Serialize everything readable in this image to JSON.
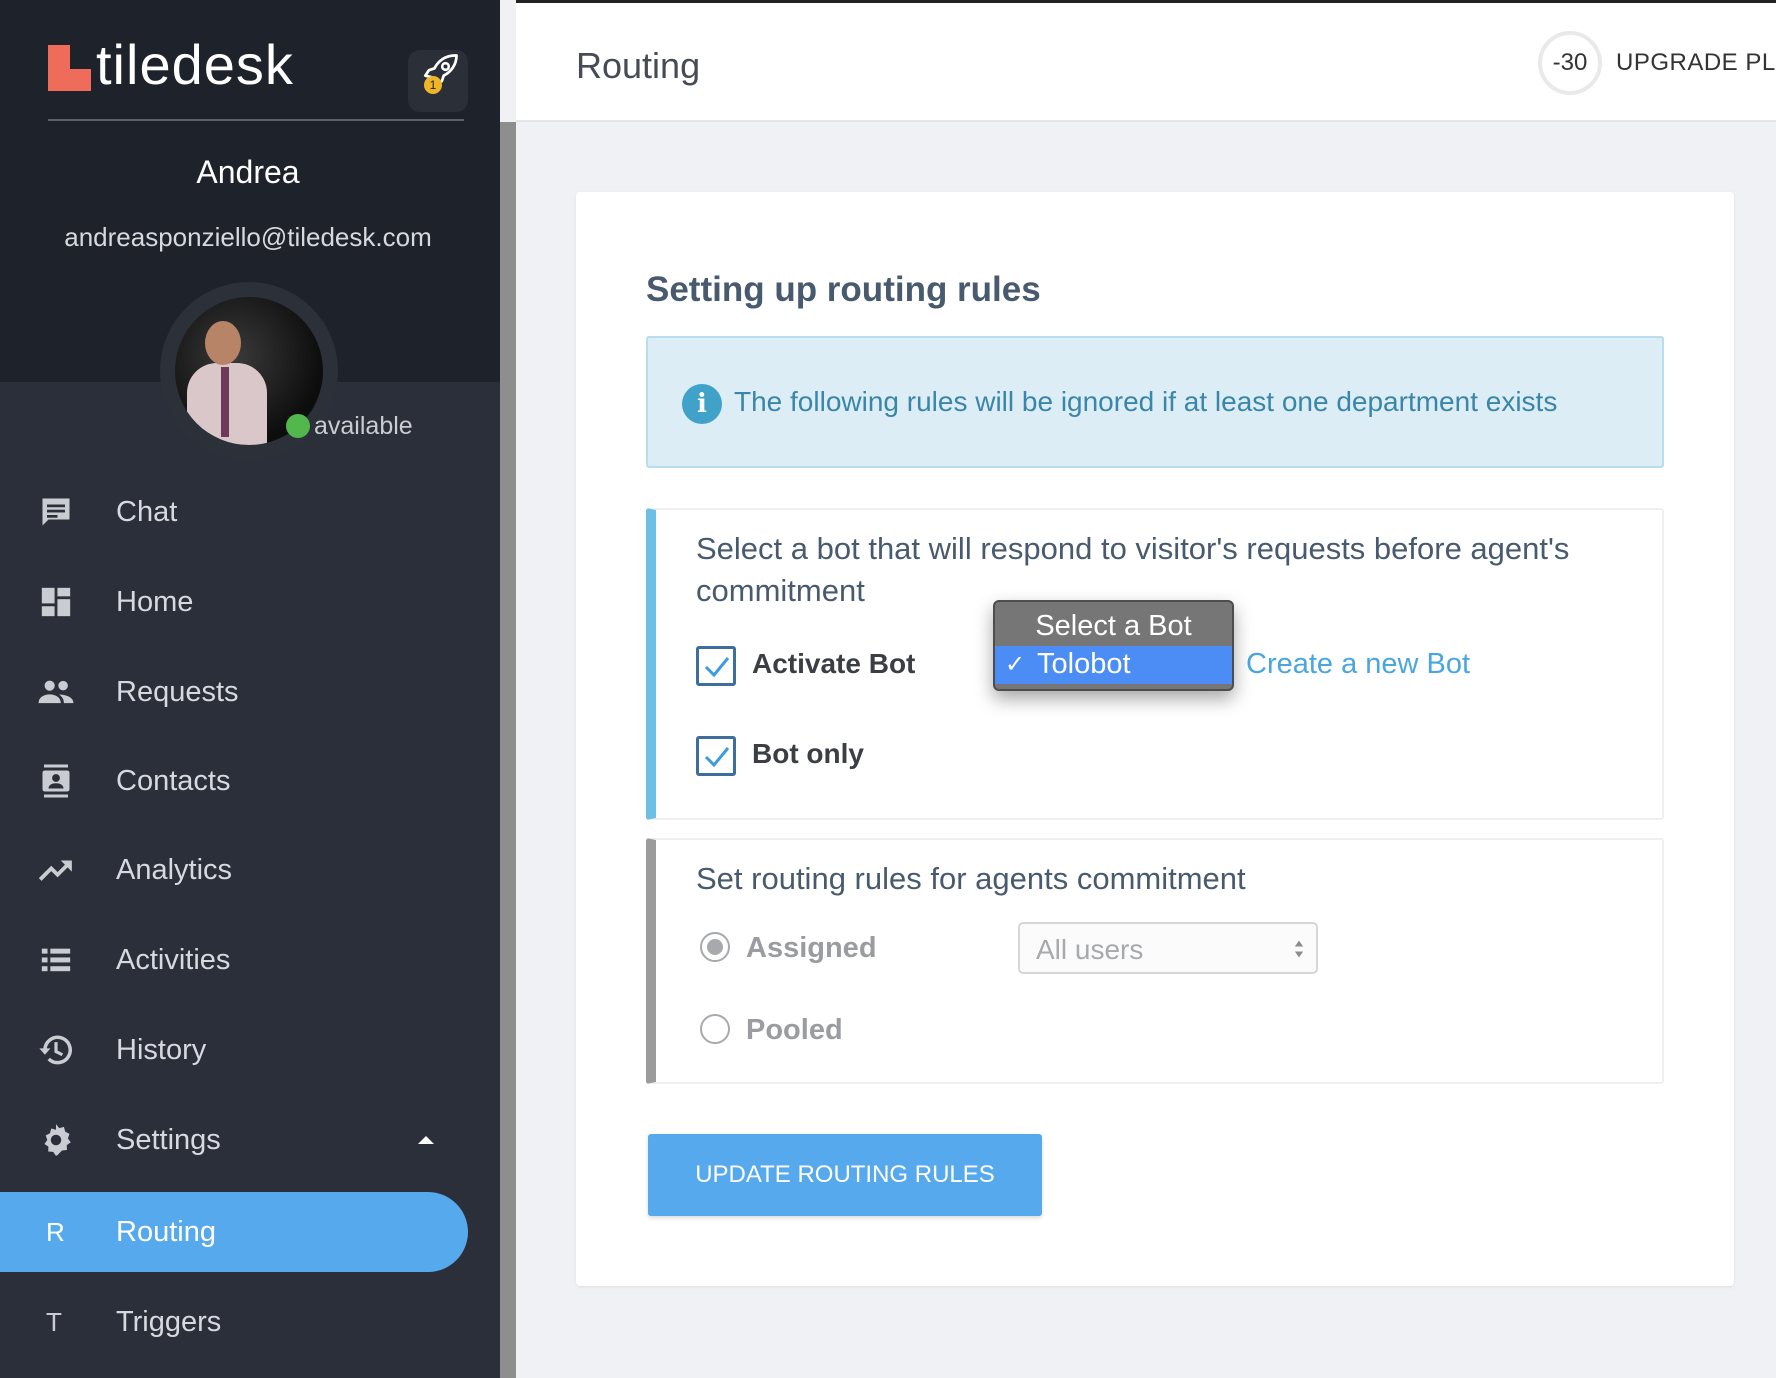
{
  "app": {
    "logo_text": "tiledesk",
    "notification_count": "1"
  },
  "user": {
    "name": "Andrea",
    "email": "andreasponziello@tiledesk.com",
    "status": "available"
  },
  "sidebar": {
    "items": [
      {
        "label": "Chat",
        "icon": "chat-icon"
      },
      {
        "label": "Home",
        "icon": "dashboard-icon"
      },
      {
        "label": "Requests",
        "icon": "people-icon"
      },
      {
        "label": "Contacts",
        "icon": "contacts-icon"
      },
      {
        "label": "Analytics",
        "icon": "trending-up-icon"
      },
      {
        "label": "Activities",
        "icon": "list-icon"
      },
      {
        "label": "History",
        "icon": "history-icon"
      },
      {
        "label": "Settings",
        "icon": "gear-icon"
      }
    ],
    "sub_items": [
      {
        "letter": "R",
        "label": "Routing",
        "active": true
      },
      {
        "letter": "T",
        "label": "Triggers",
        "active": false
      }
    ]
  },
  "header": {
    "title": "Routing",
    "trial_days": "-30",
    "upgrade_label": "UPGRADE PLA"
  },
  "main": {
    "title": "Setting up routing rules",
    "info_text": "The following rules will be ignored if at least one department exists",
    "bot_section": {
      "heading": "Select a bot that will respond to visitor's requests before agent's commitment",
      "activate_bot_label": "Activate Bot",
      "activate_bot_checked": true,
      "bot_only_label": "Bot only",
      "bot_only_checked": true,
      "create_bot_link": "Create a new Bot",
      "dropdown": {
        "header": "Select a Bot",
        "selected_option": "Tolobot"
      }
    },
    "agent_section": {
      "heading": "Set routing rules for agents commitment",
      "assigned_label": "Assigned",
      "pooled_label": "Pooled",
      "selected_mode": "Assigned",
      "users_select_value": "All users"
    },
    "update_button": "UPDATE ROUTING RULES"
  },
  "colors": {
    "accent": "#57a9ee",
    "sidebar_bg": "#2a2f3a",
    "logo": "#f06c5a",
    "bot_panel_border": "#6cc0e5"
  }
}
